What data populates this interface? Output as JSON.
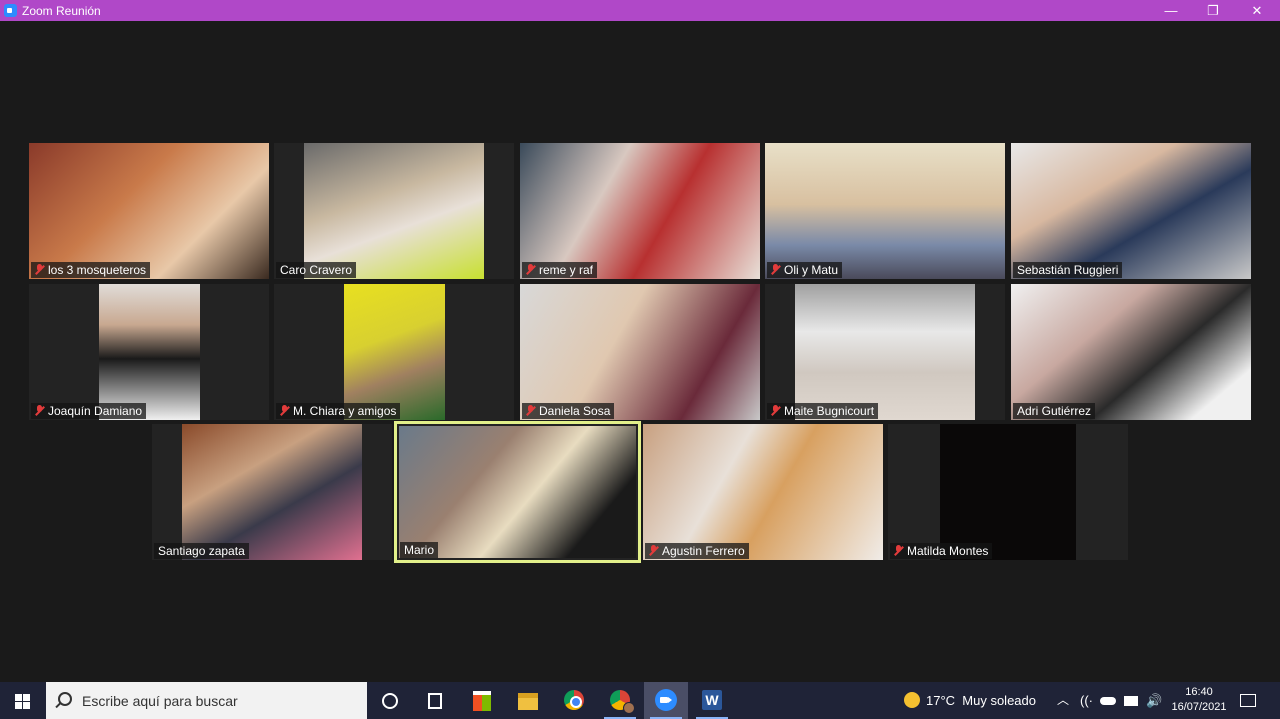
{
  "window": {
    "title": "Zoom Reunión",
    "minimize": "—",
    "maximize": "❐",
    "close": "✕"
  },
  "participants": [
    {
      "name": "los 3 mosqueteros",
      "muted": true
    },
    {
      "name": "Caro Cravero",
      "muted": false
    },
    {
      "name": "reme y raf",
      "muted": true
    },
    {
      "name": "Oli y Matu",
      "muted": true
    },
    {
      "name": "Sebastián Ruggieri",
      "muted": false
    },
    {
      "name": "Joaquín Damiano",
      "muted": true
    },
    {
      "name": "M. Chiara y amigos",
      "muted": true
    },
    {
      "name": "Daniela Sosa",
      "muted": true
    },
    {
      "name": "Maite Bugnicourt",
      "muted": true
    },
    {
      "name": "Adri Gutiérrez",
      "muted": false
    },
    {
      "name": "Santiago zapata",
      "muted": false
    },
    {
      "name": "Mario",
      "muted": false,
      "active_speaker": true
    },
    {
      "name": "Agustin Ferrero",
      "muted": true
    },
    {
      "name": "Matilda Montes",
      "muted": true
    }
  ],
  "taskbar": {
    "search_placeholder": "Escribe aquí para buscar",
    "weather_temp": "17°C",
    "weather_text": "Muy soleado",
    "time": "16:40",
    "date": "16/07/2021"
  },
  "colors": {
    "titlebar": "#b048c8",
    "active_speaker_border": "#e2f08a",
    "muted_icon": "#e23b3b",
    "taskbar": "#1f2337"
  }
}
